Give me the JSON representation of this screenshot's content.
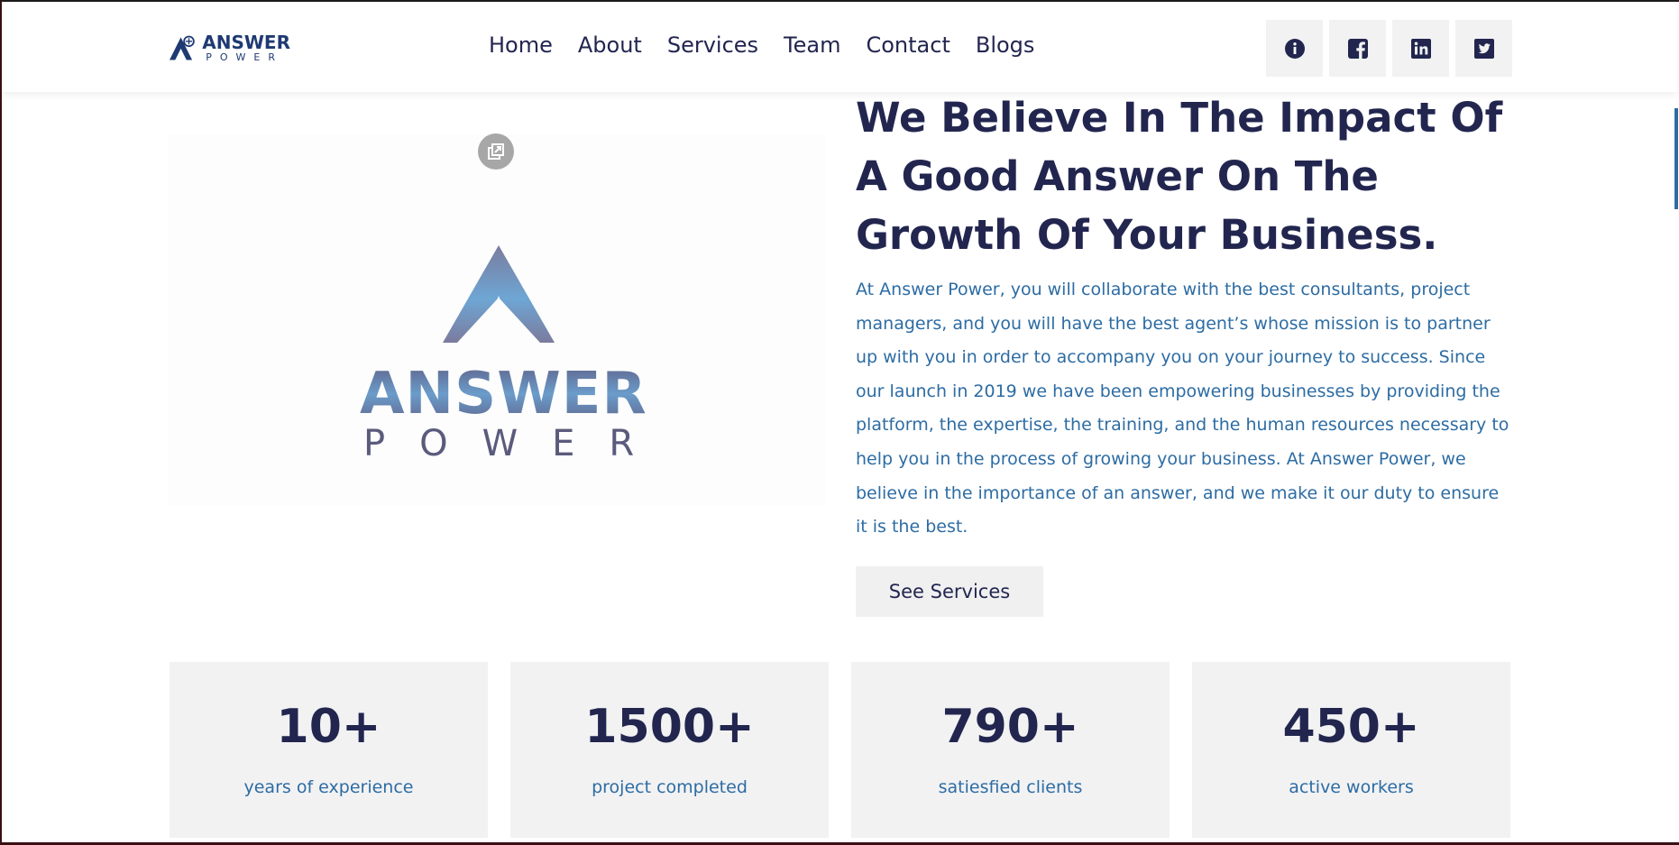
{
  "header": {
    "logo": {
      "word": "ANSWER",
      "sub": "POWER"
    },
    "nav": [
      "Home",
      "About",
      "Services",
      "Team",
      "Contact",
      "Blogs"
    ],
    "socials": [
      {
        "icon": "info-icon"
      },
      {
        "icon": "facebook-icon"
      },
      {
        "icon": "linkedin-icon"
      },
      {
        "icon": "twitter-icon"
      }
    ]
  },
  "hero": {
    "image_logo": {
      "word": "ANSWER",
      "sub": "POWER"
    },
    "title": "We Believe In The Impact Of A Good Answer On The Growth Of Your Business.",
    "body": "At Answer Power, you will collaborate with the best consultants, project managers, and you will have the best agent’s whose mission is to partner up with you in order to accompany you on your journey to success. Since our launch in 2019 we have been empowering businesses by providing the platform, the expertise, the training, and the human resources necessary to help you in the process of growing your business. At Answer Power, we believe in the importance of an answer, and we make it our duty to ensure it is the best.",
    "button": "See Services"
  },
  "stats": [
    {
      "value": "10+",
      "label": "years of experience"
    },
    {
      "value": "1500+",
      "label": "project completed"
    },
    {
      "value": "790+",
      "label": "satiesfied clients"
    },
    {
      "value": "450+",
      "label": "active workers"
    }
  ],
  "colors": {
    "navy": "#22264f",
    "blue": "#2d6ca3",
    "card_bg": "#f2f2f3"
  }
}
